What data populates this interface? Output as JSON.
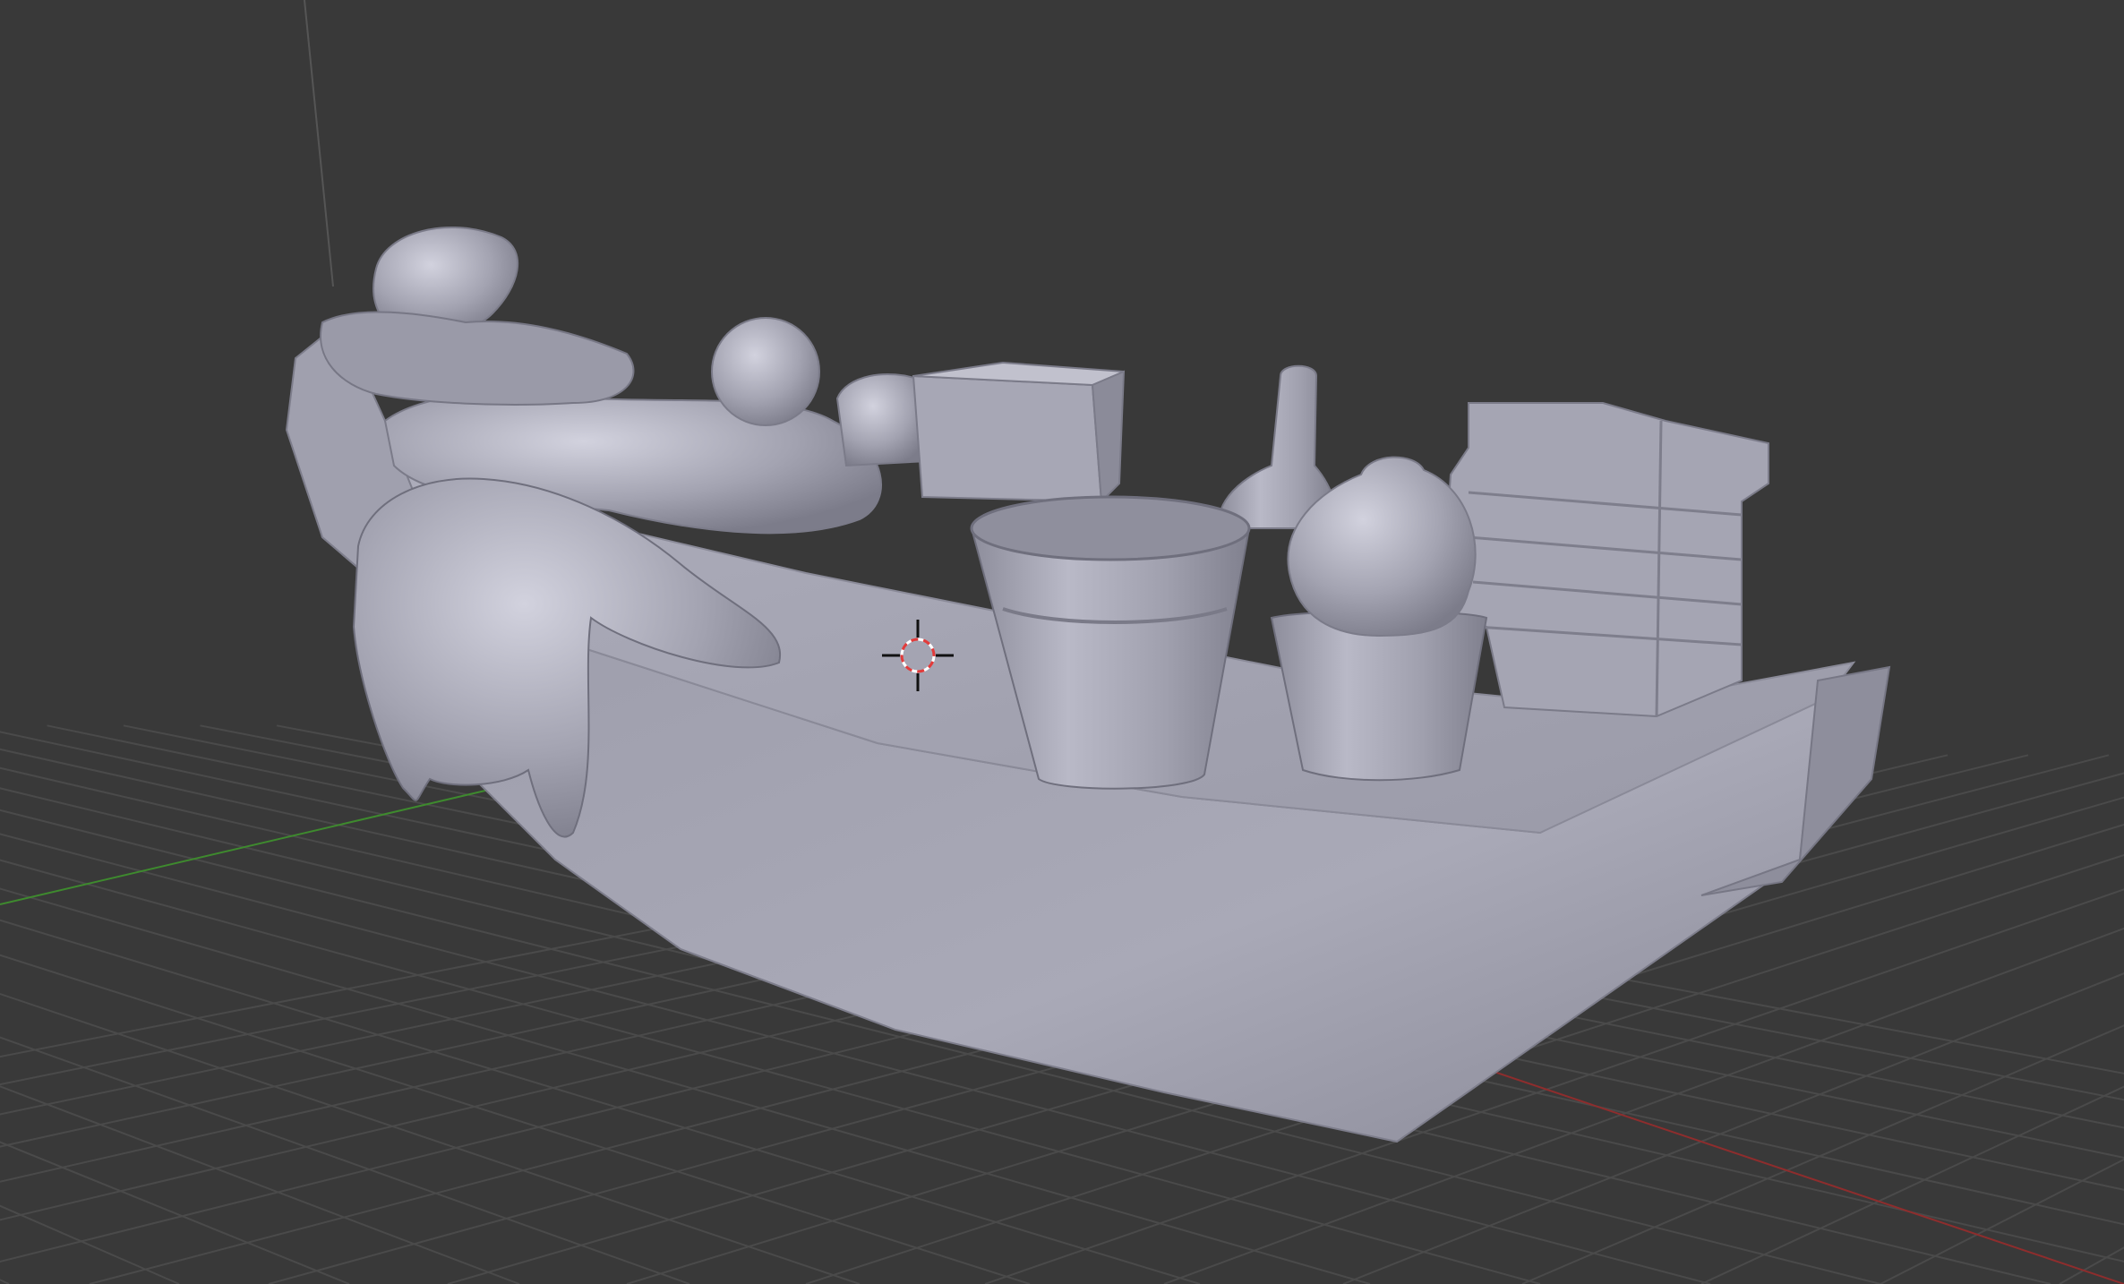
{
  "viewport": {
    "background": "#393939",
    "grid_color": "#4a4a4a",
    "x_axis_color": "#8e2d2d",
    "y_axis_color": "#3e8a2e",
    "z_axis_color": "#555555",
    "mesh_color": "#a3a3b1",
    "mesh_shadow_color": "#6d6d7a",
    "mesh_highlight_color": "#cfcfdb",
    "cursor_icon": "3d-cursor-icon"
  }
}
